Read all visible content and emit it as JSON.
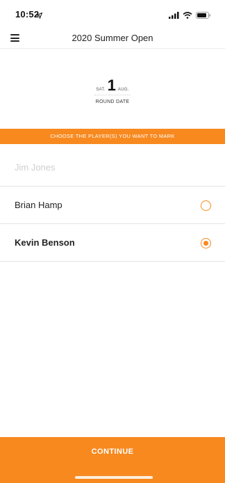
{
  "status_bar": {
    "time": "10:52",
    "icons": [
      "location-arrow-icon",
      "cellular-signal-icon",
      "wifi-icon",
      "battery-icon"
    ]
  },
  "nav": {
    "title": "2020 Summer Open",
    "menu_icon": "hamburger-menu-icon"
  },
  "round_date": {
    "day_of_week": "SAT.",
    "day": "1",
    "month": "AUG.",
    "caption": "ROUND DATE"
  },
  "banner": {
    "text": "CHOOSE THE PLAYER(S) YOU WANT TO MARK"
  },
  "players": [
    {
      "name": "Jim Jones",
      "state": "disabled"
    },
    {
      "name": "Brian Hamp",
      "state": "unselected"
    },
    {
      "name": "Kevin Benson",
      "state": "selected"
    }
  ],
  "footer": {
    "continue_label": "CONTINUE"
  },
  "colors": {
    "accent": "#f7891f",
    "disabled_text": "#cfcfcf",
    "divider": "#e3e3e3"
  }
}
